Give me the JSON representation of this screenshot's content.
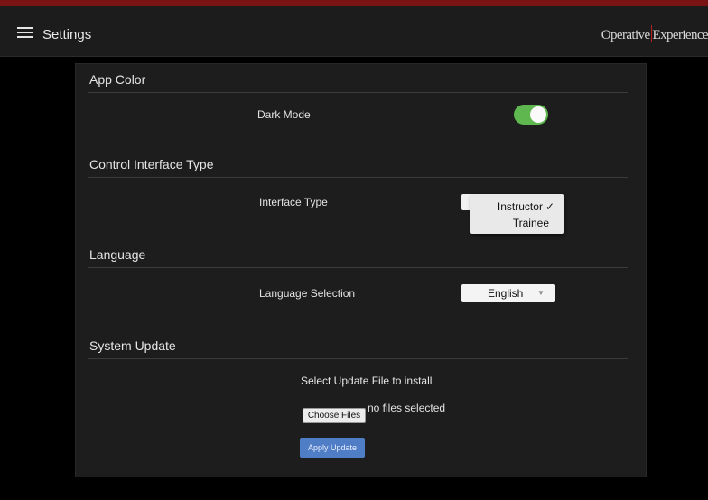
{
  "header": {
    "title": "Settings",
    "brand_left": "Operative",
    "brand_right": "Experience",
    "menu_icon": "hamburger-menu-icon"
  },
  "colors": {
    "accent_bar": "#7a1414",
    "toggle_on": "#5fb84f",
    "primary_button": "#4f7dc6",
    "panel_bg": "#1d1d1d"
  },
  "sections": {
    "app_color": {
      "title": "App Color",
      "dark_mode_label": "Dark Mode",
      "dark_mode_on": true
    },
    "control_interface": {
      "title": "Control Interface Type",
      "interface_label": "Interface Type",
      "options": [
        {
          "label": "Instructor",
          "selected": true,
          "check": "✓"
        },
        {
          "label": "Trainee",
          "selected": false,
          "check": ""
        }
      ]
    },
    "language": {
      "title": "Language",
      "selection_label": "Language Selection",
      "selected_value": "English",
      "caret": "▼"
    },
    "system_update": {
      "title": "System Update",
      "select_label": "Select Update File to install",
      "choose_button": "Choose Files",
      "no_files_text": "no files selected",
      "apply_button": "Apply Update"
    }
  }
}
